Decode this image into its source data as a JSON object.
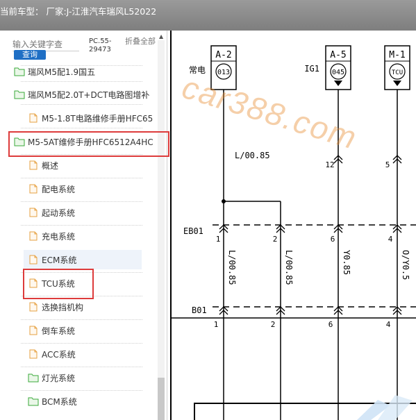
{
  "window": {
    "title": "当前车型：  厂家:J-江淮汽车瑞风L52022"
  },
  "search": {
    "placeholder": "输入关键字查",
    "button": "查询",
    "pc_code": "PC.55-29473",
    "fold_all": "折叠全部"
  },
  "tree": {
    "items": [
      {
        "label": "瑞风M5配1.9国五",
        "icon": "folder-icon"
      },
      {
        "label": "瑞风M5配2.0T+DCT电路图增补",
        "icon": "folder-icon"
      },
      {
        "label": "M5-1.8T电路维修手册HFC65",
        "icon": "document-icon"
      },
      {
        "label": "M5-5AT维修手册HFC6512A4HC",
        "icon": "folder-icon"
      },
      {
        "label": "概述",
        "icon": "document-icon"
      },
      {
        "label": "配电系统",
        "icon": "document-icon"
      },
      {
        "label": "起动系统",
        "icon": "document-icon"
      },
      {
        "label": "充电系统",
        "icon": "document-icon"
      },
      {
        "label": "ECM系统",
        "icon": "document-icon"
      },
      {
        "label": "TCU系统",
        "icon": "document-icon"
      },
      {
        "label": "选换挡机构",
        "icon": "document-icon"
      },
      {
        "label": "倒车系统",
        "icon": "document-icon"
      },
      {
        "label": "ACC系统",
        "icon": "document-icon"
      },
      {
        "label": "灯光系统",
        "icon": "folder-icon"
      },
      {
        "label": "BCM系统",
        "icon": "folder-icon"
      }
    ]
  },
  "diagram": {
    "watermark": "car388.com",
    "fuses": [
      {
        "label": "A-2",
        "code": "013",
        "prefix": "常电"
      },
      {
        "label": "A-5",
        "code": "045",
        "prefix": "IG1"
      },
      {
        "label": "M-1",
        "code": "TCU",
        "prefix": ""
      }
    ],
    "wire_top": "L/00.85",
    "pin_top_12": "12",
    "pin_top_5": "5",
    "connector_eb01": "EB01",
    "connector_b01": "B01",
    "pins": [
      "1",
      "2",
      "6",
      "4"
    ],
    "wires": [
      "L/00.85",
      "L/00.85",
      "Y0.85",
      "O/Y0.5"
    ]
  },
  "colors": {
    "highlight_box": "#dd3b3b",
    "folder": "#3aa83a",
    "document": "#e6a040",
    "query_button": "#1f6fc5"
  }
}
